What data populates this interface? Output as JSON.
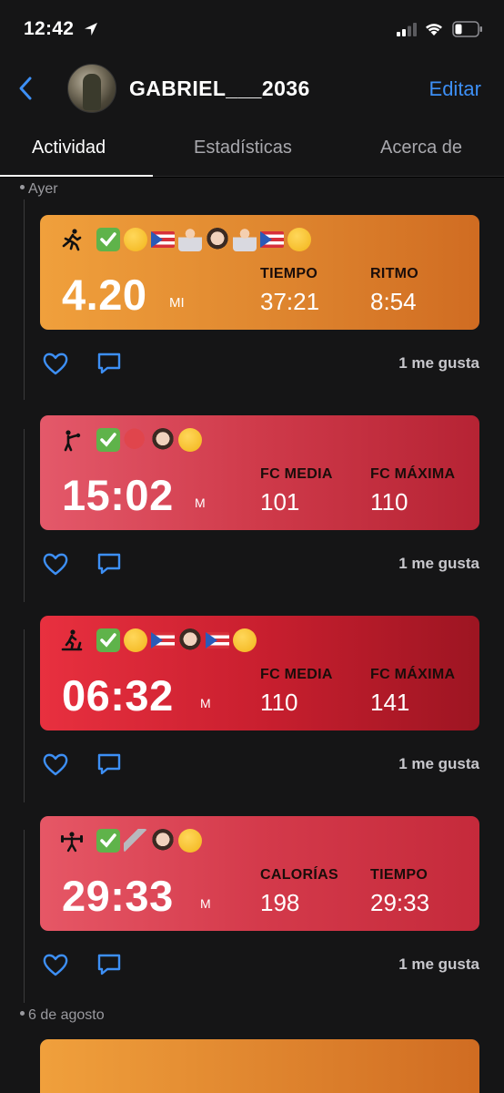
{
  "status_bar": {
    "time": "12:42"
  },
  "header": {
    "username": "GABRIEL___2036",
    "edit_label": "Editar"
  },
  "tabs": [
    {
      "label": "Actividad",
      "active": true
    },
    {
      "label": "Estadísticas",
      "active": false
    },
    {
      "label": "Acerca de",
      "active": false
    }
  ],
  "feed": {
    "groups": [
      {
        "date": "Ayer"
      },
      {
        "date": "6 de agosto"
      }
    ],
    "workouts": [
      {
        "activity_icon": "running-icon",
        "emojis": [
          "check-mark-emoji",
          "winking-face-emoji",
          "puerto-rico-flag-emoji",
          "runner-emoji",
          "bearded-man-emoji",
          "runner-emoji",
          "puerto-rico-flag-emoji",
          "winking-face-emoji"
        ],
        "value": "4.20",
        "unit": "MI",
        "stats": [
          {
            "label": "TIEMPO",
            "value": "37:21"
          },
          {
            "label": "RITMO",
            "value": "8:54"
          }
        ],
        "likes": "1 me gusta",
        "color": "#e08830"
      },
      {
        "activity_icon": "boxing-icon",
        "emojis": [
          "check-mark-emoji",
          "boxing-glove-emoji",
          "bearded-man-emoji",
          "winking-face-emoji"
        ],
        "value": "15:02",
        "unit": "M",
        "stats": [
          {
            "label": "FC MEDIA",
            "value": "101"
          },
          {
            "label": "FC MÁXIMA",
            "value": "110"
          }
        ],
        "likes": "1 me gusta",
        "color": "#cf3a4a"
      },
      {
        "activity_icon": "treadmill-icon",
        "emojis": [
          "check-mark-emoji",
          "winking-face-emoji",
          "puerto-rico-flag-emoji",
          "bearded-man-emoji",
          "puerto-rico-flag-emoji",
          "winking-face-emoji"
        ],
        "value": "06:32",
        "unit": "M",
        "stats": [
          {
            "label": "FC MEDIA",
            "value": "110"
          },
          {
            "label": "FC MÁXIMA",
            "value": "141"
          }
        ],
        "likes": "1 me gusta",
        "color": "#c91f2f"
      },
      {
        "activity_icon": "weightlifting-icon",
        "emojis": [
          "check-mark-emoji",
          "leg-emoji",
          "bearded-man-emoji",
          "winking-face-emoji"
        ],
        "value": "29:33",
        "unit": "M",
        "stats": [
          {
            "label": "CALORÍAS",
            "value": "198"
          },
          {
            "label": "TIEMPO",
            "value": "29:33"
          }
        ],
        "likes": "1 me gusta",
        "color": "#d43a4b"
      }
    ]
  },
  "colors": {
    "accent": "#3d8ff5",
    "background": "#151516"
  }
}
